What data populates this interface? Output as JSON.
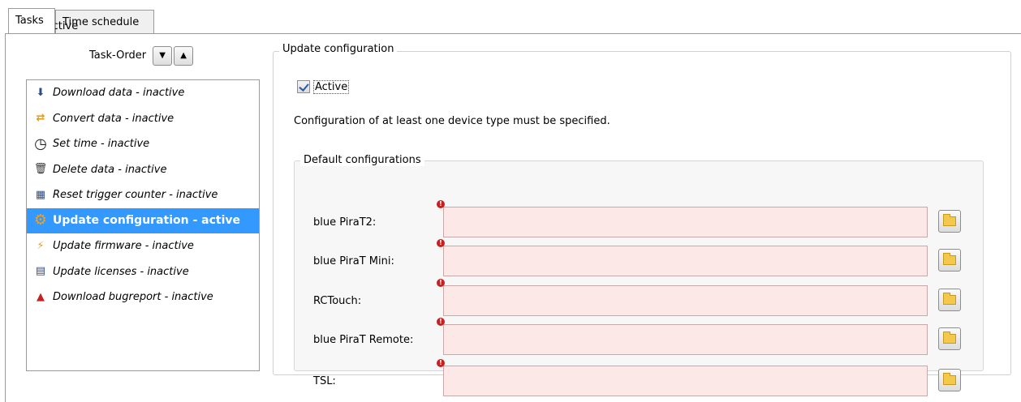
{
  "tabs": [
    {
      "label": "Tasks",
      "active": true
    },
    {
      "label": "Time schedule",
      "active": false
    }
  ],
  "active_checkbox": {
    "label": "Active",
    "checked": true
  },
  "task_order": {
    "label": "Task-Order",
    "down_icon": "▼",
    "up_icon": "▲"
  },
  "tasks": [
    {
      "label": "Download data - inactive",
      "icon": "download-icon",
      "glyph": "⬇"
    },
    {
      "label": "Convert data - inactive",
      "icon": "convert-icon",
      "glyph": "⇄"
    },
    {
      "label": "Set time - inactive",
      "icon": "clock-icon",
      "glyph": "◷"
    },
    {
      "label": "Delete data - inactive",
      "icon": "trash-icon",
      "glyph": "🗑"
    },
    {
      "label": "Reset trigger counter - inactive",
      "icon": "counter-icon",
      "glyph": "▦"
    },
    {
      "label": "Update configuration - active",
      "icon": "gear-icon",
      "glyph": "⚙",
      "selected": true
    },
    {
      "label": "Update firmware - inactive",
      "icon": "firmware-icon",
      "glyph": "⚡"
    },
    {
      "label": "Update licenses - inactive",
      "icon": "license-icon",
      "glyph": "▤"
    },
    {
      "label": "Download bugreport - inactive",
      "icon": "bugreport-icon",
      "glyph": "▲"
    }
  ],
  "group": {
    "title": "Update configuration",
    "active_label": "Active",
    "active_checked": true,
    "info": "Configuration of at least one device type must be specified."
  },
  "defaults": {
    "title": "Default configurations",
    "rows": [
      {
        "label": "blue PiraT2:",
        "value": ""
      },
      {
        "label": "blue PiraT Mini:",
        "value": ""
      },
      {
        "label": "RCTouch:",
        "value": ""
      },
      {
        "label": "blue PiraT Remote:",
        "value": ""
      },
      {
        "label": "TSL:",
        "value": ""
      }
    ]
  },
  "colors": {
    "selection": "#3399ff",
    "field_error_bg": "#fde8e8",
    "error_marker": "#c62020"
  }
}
